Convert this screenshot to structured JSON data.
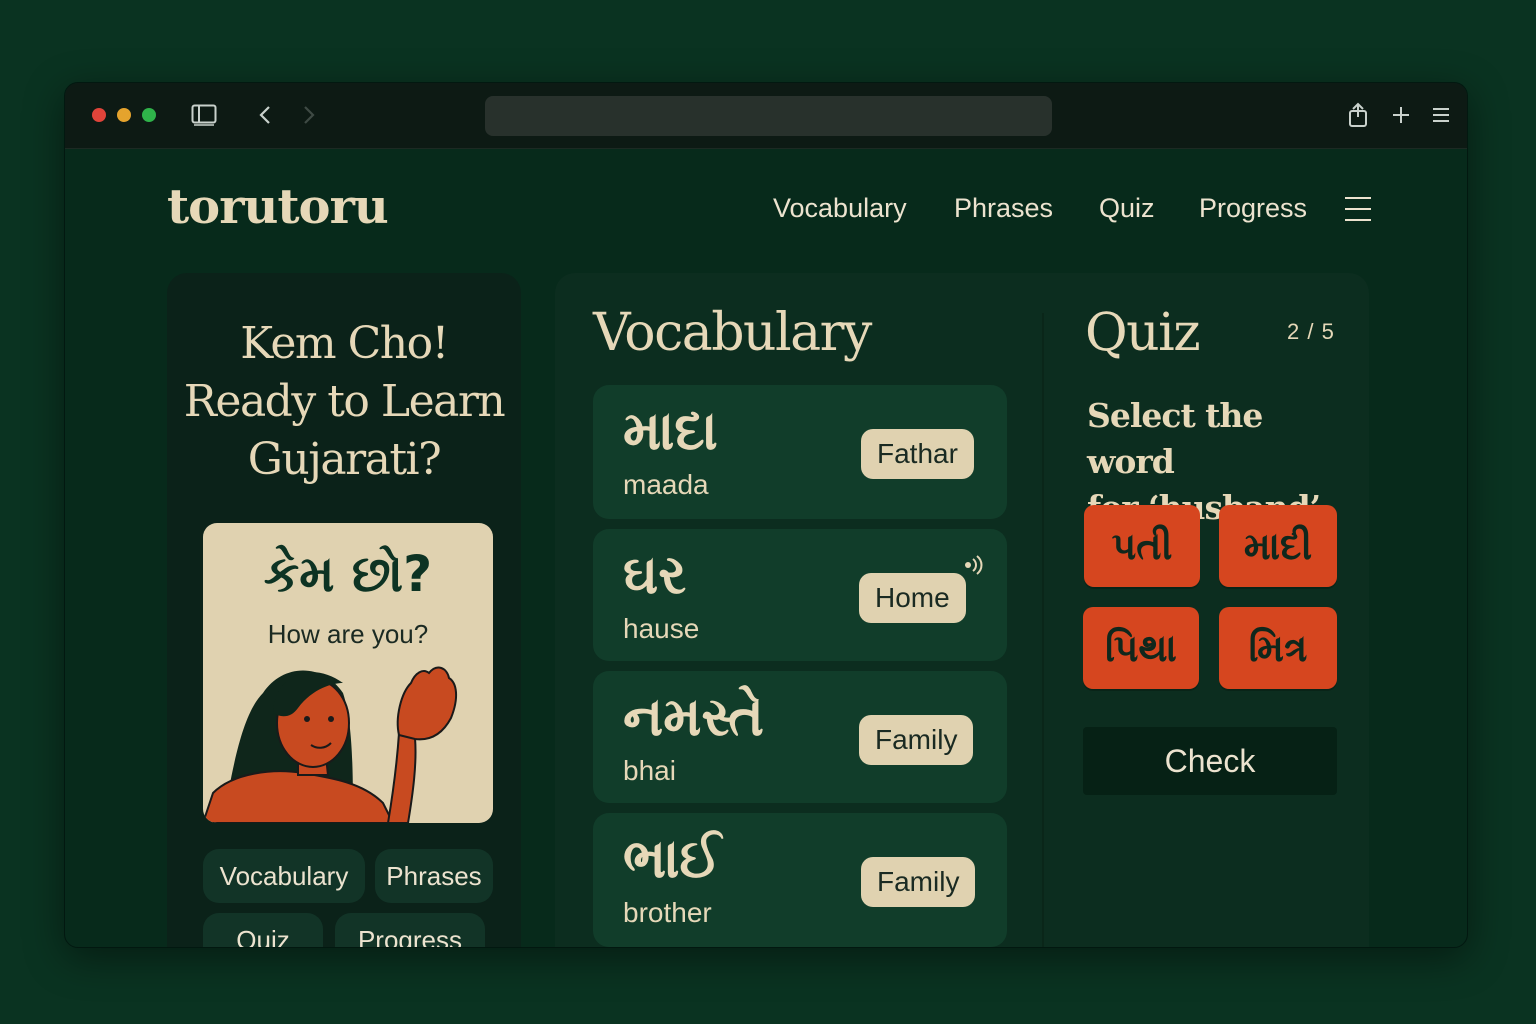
{
  "app": {
    "logo": "torutoru"
  },
  "nav": {
    "items": [
      "Vocabulary",
      "Phrases",
      "Quiz",
      "Progress"
    ]
  },
  "hero": {
    "greeting_line1": "Kem Cho!",
    "greeting_line2": "Ready to Learn",
    "greeting_line3": "Gujarati?",
    "card_native": "કેમ છો?",
    "card_translation": "How are you?",
    "chips": [
      "Vocabulary",
      "Phrases",
      "Quiz",
      "Progress"
    ]
  },
  "vocabulary": {
    "title": "Vocabulary",
    "rows": [
      {
        "native": "માદા",
        "roman": "maada",
        "tag": "Fathar"
      },
      {
        "native": "ઘર",
        "roman": "hause",
        "tag": "Home"
      },
      {
        "native": "નમસ્તે",
        "roman": "bhai",
        "tag": "Family"
      },
      {
        "native": "ભાઈ",
        "roman": "brother",
        "tag": "Family"
      }
    ]
  },
  "quiz": {
    "title": "Quiz",
    "progress": "2 / 5",
    "prompt_line1": "Select the word",
    "prompt_line2": "for ‘husband’",
    "options": [
      "પતી",
      "માદી",
      "પિથા",
      "મિત્ર"
    ],
    "check_label": "Check"
  },
  "colors": {
    "background": "#0a3321",
    "panel": "#0c2d1f",
    "accent": "#d6461f",
    "cream": "#e0d2b0"
  },
  "icons": [
    "sidebar-toggle-icon",
    "back-icon",
    "forward-icon",
    "share-icon",
    "new-tab-icon",
    "menu-icon",
    "sound-icon"
  ]
}
